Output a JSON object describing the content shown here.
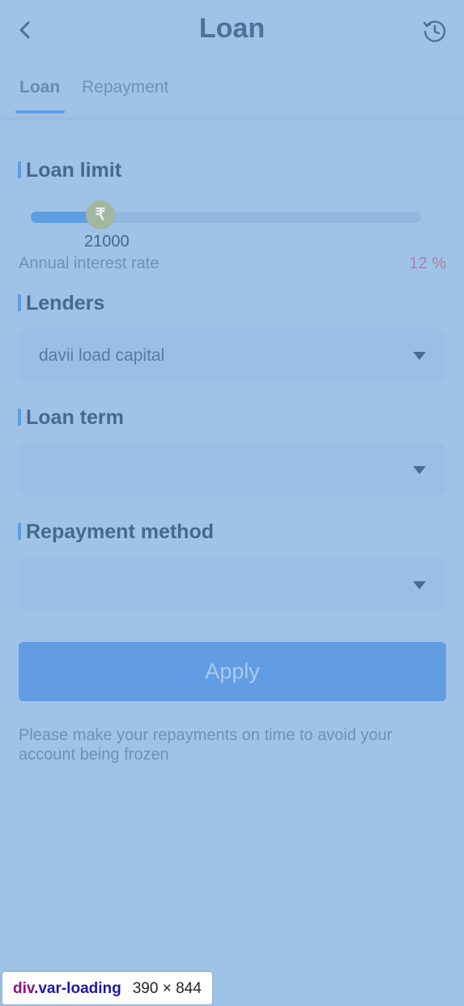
{
  "header": {
    "title": "Loan",
    "back_icon": "chevron-left-icon",
    "history_icon": "clock-history-icon"
  },
  "tabs": [
    {
      "label": "Loan",
      "active": true
    },
    {
      "label": "Repayment",
      "active": false
    }
  ],
  "loan_limit": {
    "label": "Loan limit",
    "amount": "21000",
    "currency_symbol": "₹",
    "slider_fraction": 0.18,
    "interest_label": "Annual interest rate",
    "interest_value": "12 %"
  },
  "lenders": {
    "label": "Lenders",
    "selected": "davii load capital"
  },
  "loan_term": {
    "label": "Loan term",
    "selected": ""
  },
  "repayment_method": {
    "label": "Repayment method",
    "selected": ""
  },
  "apply_button": "Apply",
  "notice": "Please make your repayments on time to avoid your account being frozen",
  "devtools_badge": {
    "tag": "div",
    "class": ".var-loading",
    "dimensions": "390 × 844"
  },
  "colors": {
    "background": "#9fc3e7",
    "accent": "#5f9ee3",
    "interest": "#b07fa0"
  }
}
